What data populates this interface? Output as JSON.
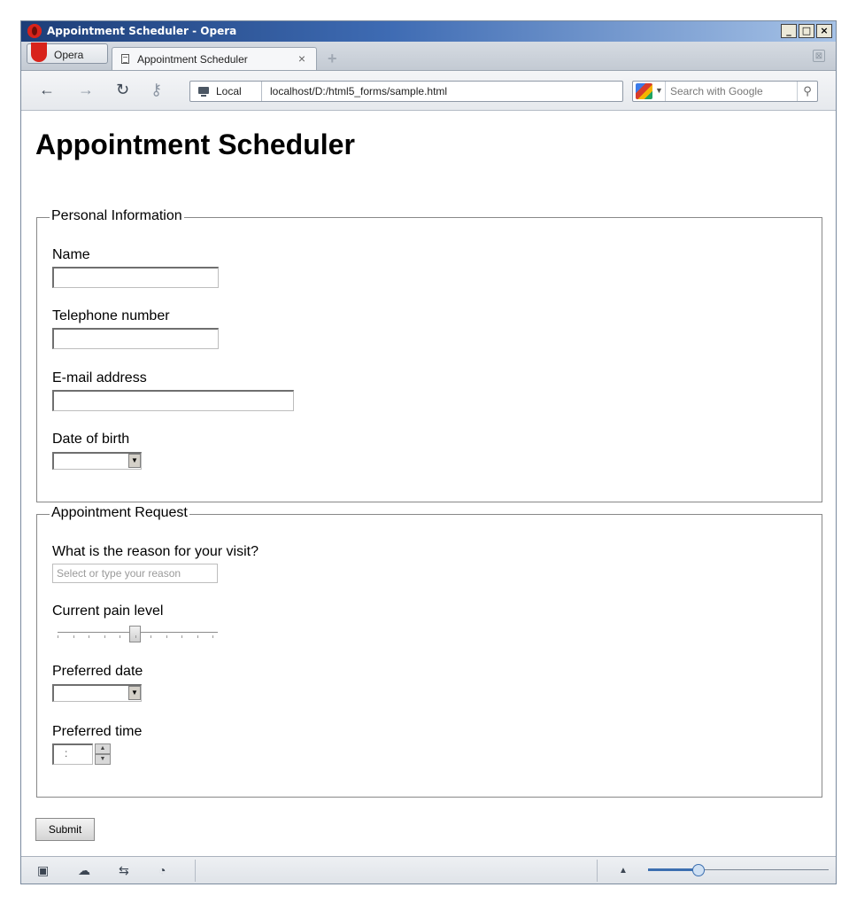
{
  "window": {
    "title": "Appointment Scheduler - Opera",
    "buttons": [
      "_",
      "□",
      "×"
    ]
  },
  "tabbar": {
    "opera_label": "Opera",
    "tab_title": "Appointment Scheduler",
    "tab_close": "×",
    "new_tab": "+",
    "trash": "⊠"
  },
  "navbar": {
    "back": "←",
    "forward": "→",
    "reload": "↻",
    "key": "⚷",
    "local_label": "Local",
    "url": "localhost/D:/html5_forms/sample.html",
    "search_placeholder": "Search with Google",
    "search_icon": "⚲"
  },
  "page": {
    "heading": "Appointment Scheduler",
    "personal": {
      "legend": "Personal Information",
      "name_label": "Name",
      "name_value": "",
      "phone_label": "Telephone number",
      "phone_value": "",
      "email_label": "E-mail address",
      "email_value": "",
      "dob_label": "Date of birth",
      "dob_value": "",
      "dropdown_arrow": "▼"
    },
    "appointment": {
      "legend": "Appointment Request",
      "reason_label": "What is the reason for your visit?",
      "reason_placeholder": "Select or type your reason",
      "pain_label": "Current pain level",
      "pain_value_fraction": 0.5,
      "date_label": "Preferred date",
      "date_value": "",
      "time_label": "Preferred time",
      "time_value": ":",
      "spin_up": "▲",
      "spin_down": "▼"
    },
    "submit_label": "Submit"
  },
  "statusbar": {
    "icons": [
      "panel-toggle-icon",
      "cloud-icon",
      "unite-icon",
      "speed-dial-icon"
    ],
    "glyphs": [
      "▣",
      "☁",
      "⇆",
      "◔"
    ],
    "zoom_arrow": "▲",
    "zoom_fraction": 0.28
  },
  "colors": {
    "titlebar_start": "#1d3e78",
    "titlebar_end": "#a7c3e7",
    "opera_red": "#d8231b"
  }
}
